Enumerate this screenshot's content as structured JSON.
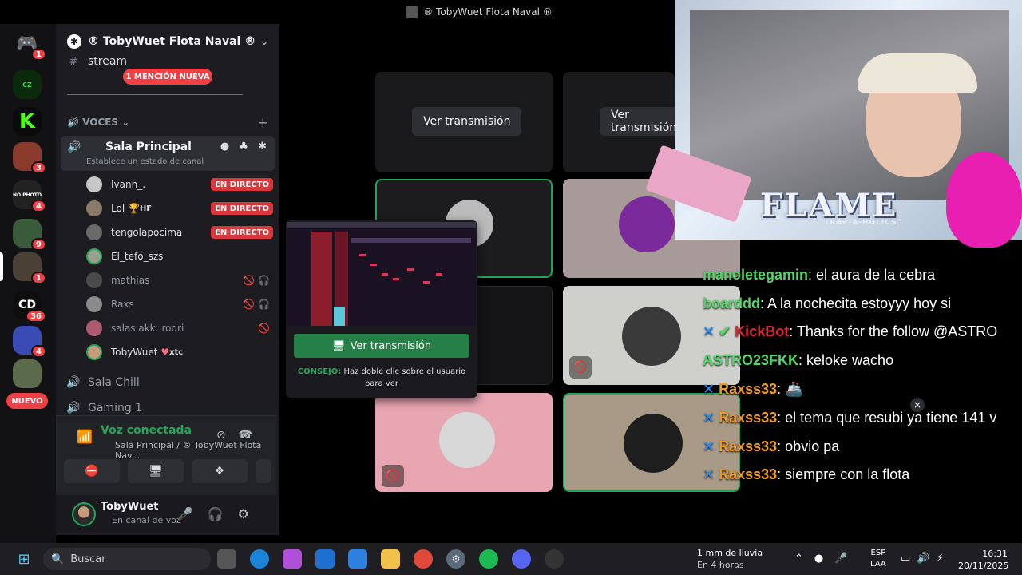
{
  "window": {
    "title": "® TobyWuet Flota Naval ®"
  },
  "server": {
    "name": "® TobyWuet Flota Naval ®"
  },
  "rail": {
    "badges": [
      "1",
      "3",
      "4",
      "9",
      "1",
      "36",
      "4"
    ],
    "new_label": "NUEVO"
  },
  "channels": {
    "stream_label": "stream",
    "mention_label": "1 MENCIÓN NUEVA",
    "voice_category": "VOCES",
    "active_channel": {
      "name": "Sala Principal",
      "status_placeholder": "Establece un estado de canal"
    },
    "voice_users": [
      {
        "name": "Ivann_.",
        "tag": "",
        "live": "EN DIRECTO"
      },
      {
        "name": "Lol",
        "tag": "HF",
        "live": "EN DIRECTO"
      },
      {
        "name": "tengolapocima",
        "tag": "",
        "live": "EN DIRECTO"
      },
      {
        "name": "El_tefo_szs",
        "tag": "",
        "live": ""
      },
      {
        "name": "mathias",
        "tag": "",
        "live": ""
      },
      {
        "name": "Raxs",
        "tag": "",
        "live": ""
      },
      {
        "name": "salas akk: rodri",
        "tag": "",
        "live": ""
      },
      {
        "name": "TobyWuet",
        "tag": "xtc",
        "live": ""
      }
    ],
    "other_channels": [
      "Sala Chill",
      "Gaming 1"
    ]
  },
  "voice_panel": {
    "status": "Voz conectada",
    "location": "Sala Principal / ® TobyWuet Flota Nav..."
  },
  "user": {
    "name": "TobyWuet",
    "status": "En canal de voz"
  },
  "stream_grid": {
    "watch_label": "Ver transmisión"
  },
  "preview": {
    "watch_label": "Ver transmisión",
    "tip_label": "CONSEJO:",
    "tip_text": "Haz doble clic sobre el usuario para ver"
  },
  "overlay": {
    "brand": "FLAME",
    "brand_sub": "TRAP-A-HOLICS"
  },
  "chat": [
    {
      "user": "manoletegamin",
      "text": ": el aura de la cebra"
    },
    {
      "user": "boarddd",
      "text": ": A la nochecita estoyyy hoy si"
    },
    {
      "user": "KickBot",
      "text": ": Thanks for the follow @ASTRO"
    },
    {
      "user": "ASTRO23FKK",
      "text": ": keloke wacho"
    },
    {
      "user": "Raxss33",
      "text": ":"
    },
    {
      "user": "Raxss33",
      "text": ": el tema que resubi ya tiene 141 v"
    },
    {
      "user": "Raxss33",
      "text": ": obvio pa"
    },
    {
      "user": "Raxss33",
      "text": ": siempre con la flota"
    }
  ],
  "taskbar": {
    "search_placeholder": "Buscar",
    "weather_main": "1 mm de lluvia",
    "weather_sub": "En 4 horas",
    "lang_1": "ESP",
    "lang_2": "LAA",
    "time": "16:31",
    "date": "20/11/2025"
  },
  "colors": {
    "live": "#da373c",
    "connected": "#23a55a",
    "watch_button": "#248046",
    "mention": "#f23f43"
  }
}
